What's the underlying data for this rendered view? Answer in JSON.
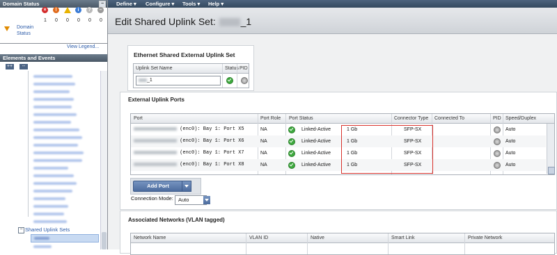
{
  "domain_status": {
    "title": "Domain Status",
    "collapse_glyph": "−",
    "label_line1": "Domain",
    "label_line2": "Status",
    "counts": [
      "1",
      "0",
      "0",
      "0",
      "0",
      "0"
    ],
    "icons": [
      "critical-icon",
      "major-icon",
      "warning-icon",
      "info-icon",
      "unknown-icon",
      "disabled-icon"
    ],
    "view_legend": "View Legend..."
  },
  "elements_events": {
    "title": "Elements and Events",
    "expand_btn": "++",
    "collapse_btn": "--",
    "tree_shared_uplink_sets": "Shared Uplink Sets"
  },
  "menu": [
    "Define ▾",
    "Configure ▾",
    "Tools ▾",
    "Help ▾"
  ],
  "page": {
    "title_prefix": "Edit Shared Uplink Set:",
    "title_suffix": "_1"
  },
  "ethernet_set": {
    "heading": "Ethernet Shared External Uplink Set",
    "col_name": "Uplink Set Name",
    "col_status": "Status",
    "col_pid": "PID",
    "name_value": "_1"
  },
  "external_ports": {
    "heading": "External Uplink Ports",
    "columns": [
      "Port",
      "Port Role",
      "Port Status",
      "Connector Type",
      "Connected To",
      "PID",
      "Speed/Duplex"
    ],
    "rows": [
      {
        "port": "(enc0): Bay 1: Port X5",
        "role": "NA",
        "status": "Linked-Active",
        "speed": "1 Gb",
        "connector": "SFP-SX",
        "duplex": "Auto"
      },
      {
        "port": "(enc0): Bay 1: Port X6",
        "role": "NA",
        "status": "Linked-Active",
        "speed": "1 Gb",
        "connector": "SFP-SX",
        "duplex": "Auto"
      },
      {
        "port": "(enc0): Bay 1: Port X7",
        "role": "NA",
        "status": "Linked-Active",
        "speed": "1 Gb",
        "connector": "SFP-SX",
        "duplex": "Auto"
      },
      {
        "port": "(enc0): Bay 1: Port X8",
        "role": "NA",
        "status": "Linked-Active",
        "speed": "1 Gb",
        "connector": "SFP-SX",
        "duplex": "Auto"
      }
    ],
    "add_port": "Add Port",
    "connection_mode_label": "Connection Mode:",
    "connection_mode_value": "Auto"
  },
  "assoc_networks": {
    "heading": "Associated Networks (VLAN tagged)",
    "columns": [
      "Network Name",
      "VLAN ID",
      "Native",
      "Smart Link",
      "Private Network"
    ]
  },
  "colors": {
    "accent": "#4c6c9e",
    "highlight_box": "#d8302a",
    "ok_green": "#3faa3f"
  }
}
